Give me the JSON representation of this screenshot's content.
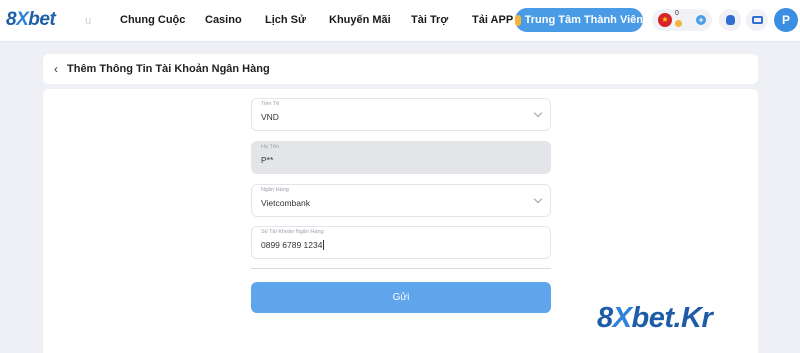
{
  "header": {
    "logo": {
      "brand_left": "8",
      "brand_x": "X",
      "brand_right": "bet"
    },
    "nav_cut": "u",
    "nav": [
      "Chung Cuộc",
      "Casino",
      "Lịch Sử",
      "Khuyến Mãi",
      "Tài Trợ",
      "Tải APP"
    ],
    "member_center": "Trung Tâm Thành Viên",
    "balance_value": "0",
    "avatar_letter": "P"
  },
  "page": {
    "back_icon": "‹",
    "title": "Thêm Thông Tin Tài Khoản Ngân Hàng"
  },
  "form": {
    "currency": {
      "label": "Tiền Tệ",
      "value": "VND"
    },
    "fullname": {
      "label": "Họ Tên",
      "value": "P**"
    },
    "bank": {
      "label": "Ngân Hàng",
      "value": "Vietcombank"
    },
    "account_number": {
      "label": "Số Tài Khoản Ngân Hàng",
      "value": "0899 6789 1234"
    },
    "submit_label": "Gửi"
  },
  "watermark": {
    "left": "8",
    "x": "X",
    "right": "bet.Kr"
  },
  "colors": {
    "primary": "#4a9be6",
    "brand": "#1f5ea8",
    "submit": "#5fa5ec"
  }
}
